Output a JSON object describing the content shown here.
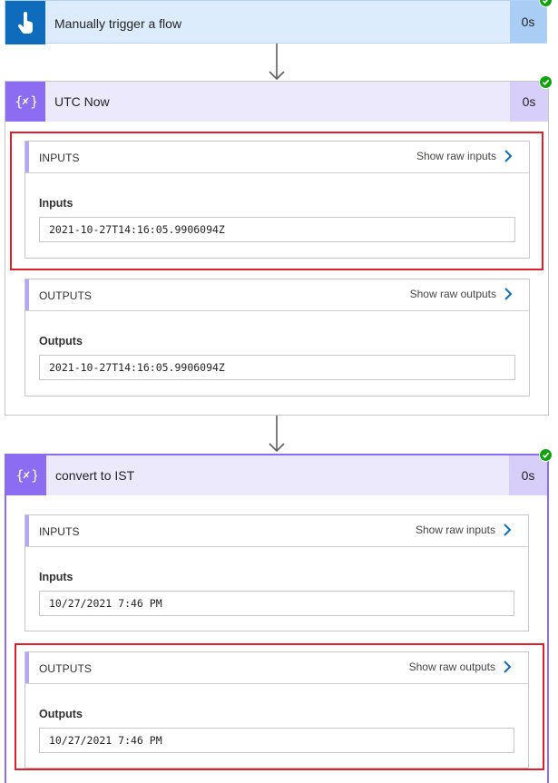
{
  "trigger": {
    "title": "Manually trigger a flow",
    "duration": "0s",
    "icon": "touch-hand-icon",
    "header_color": "#dcecfd",
    "icon_bg": "#0f6cbd"
  },
  "utc_now": {
    "title": "UTC Now",
    "duration": "0s",
    "icon": "expression-icon",
    "status": "succeeded",
    "inputs": {
      "label": "INPUTS",
      "raw_link": "Show raw inputs",
      "field_label": "Inputs",
      "value": "2021-10-27T14:16:05.9906094Z"
    },
    "outputs": {
      "label": "OUTPUTS",
      "raw_link": "Show raw outputs",
      "field_label": "Outputs",
      "value": "2021-10-27T14:16:05.9906094Z"
    }
  },
  "convert": {
    "title": "convert to IST",
    "duration": "0s",
    "icon": "expression-icon",
    "status": "succeeded",
    "inputs": {
      "label": "INPUTS",
      "raw_link": "Show raw inputs",
      "field_label": "Inputs",
      "value": "10/27/2021 7:46 PM"
    },
    "outputs": {
      "label": "OUTPUTS",
      "raw_link": "Show raw outputs",
      "field_label": "Outputs",
      "value": "10/27/2021 7:46 PM"
    }
  },
  "colors": {
    "action_header": "#ede9fd",
    "action_icon_bg": "#8c6cf0",
    "duration_bg_action": "#d7cffa",
    "success": "#13a10e",
    "highlight": "#e11d2a"
  }
}
